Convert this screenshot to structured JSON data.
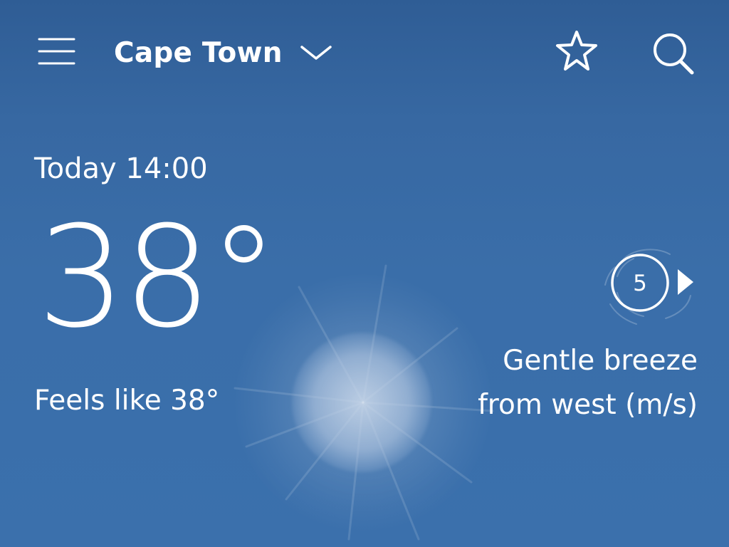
{
  "header": {
    "location": "Cape Town"
  },
  "current": {
    "time_label": "Today 14:00",
    "temperature": "38°",
    "feels_like": "Feels like 38°"
  },
  "wind": {
    "speed": "5",
    "description_line1": "Gentle breeze",
    "description_line2": "from west (m/s)"
  },
  "icons": {
    "menu": "menu-icon",
    "location_dropdown": "chevron-down-icon",
    "favorite": "star-icon",
    "search": "search-icon",
    "wind_direction": "wind-direction-arrow-icon"
  },
  "colors": {
    "sky_top": "#2f5d95",
    "sky_bottom": "#3b70ac",
    "text": "#ffffff"
  }
}
